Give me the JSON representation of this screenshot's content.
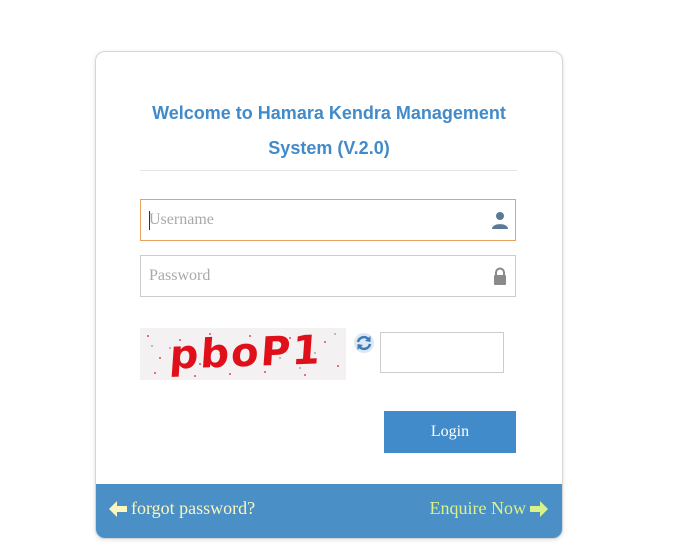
{
  "login": {
    "title": "Welcome to Hamara Kendra Management System (V.2.0)",
    "username_placeholder": "Username",
    "password_placeholder": "Password",
    "captcha_text": "pboP1",
    "captcha_value": "",
    "login_label": "Login"
  },
  "footer": {
    "forgot_label": "forgot password?",
    "enquire_label": "Enquire Now"
  },
  "icons": {
    "username": "user-icon",
    "password": "lock-icon",
    "refresh": "refresh-icon",
    "forgot_arrow": "arrow-left-icon",
    "enquire_arrow": "arrow-right-icon"
  },
  "colors": {
    "accent": "#428bca",
    "footer": "#4a8fc5",
    "forgot_link": "#fbf6bf",
    "enquire_link": "#d9f38a",
    "captcha_text": "#e0101a",
    "focus_border": "#e8a25f"
  }
}
